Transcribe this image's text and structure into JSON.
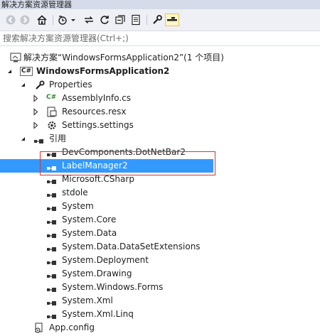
{
  "window": {
    "title": "解决方案资源管理器"
  },
  "toolbar": {
    "icons": [
      "back-icon",
      "forward-icon",
      "home-icon",
      "history-icon",
      "sync-icon",
      "refresh-icon",
      "collapse-all-icon",
      "show-all-files-icon",
      "properties-icon",
      "preview-icon"
    ]
  },
  "search": {
    "placeholder": "搜索解决方案资源管理器(Ctrl+;)"
  },
  "tree": {
    "solution": {
      "label": "解决方案“WindowsFormsApplication2”(1 个项目)"
    },
    "project": {
      "label": "WindowsFormsApplication2",
      "badge": "C#"
    },
    "properties": {
      "label": "Properties"
    },
    "assemblyinfo": {
      "label": "AssemblyInfo.cs",
      "badge": "C#"
    },
    "resources": {
      "label": "Resources.resx"
    },
    "settings": {
      "label": "Settings.settings"
    },
    "references": {
      "label": "引用"
    },
    "refs": [
      {
        "label": "DevComponents.DotNetBar2"
      },
      {
        "label": "LabelManager2",
        "selected": true
      },
      {
        "label": "Microsoft.CSharp"
      },
      {
        "label": "stdole"
      },
      {
        "label": "System"
      },
      {
        "label": "System.Core"
      },
      {
        "label": "System.Data"
      },
      {
        "label": "System.Data.DataSetExtensions"
      },
      {
        "label": "System.Deployment"
      },
      {
        "label": "System.Drawing"
      },
      {
        "label": "System.Windows.Forms"
      },
      {
        "label": "System.Xml"
      },
      {
        "label": "System.Xml.Linq"
      }
    ],
    "appconfig": {
      "label": "App.config"
    }
  },
  "colors": {
    "selection": "#3399ff",
    "highlight_box": "#e03030",
    "toolbar_bg": "#eef0f5"
  }
}
